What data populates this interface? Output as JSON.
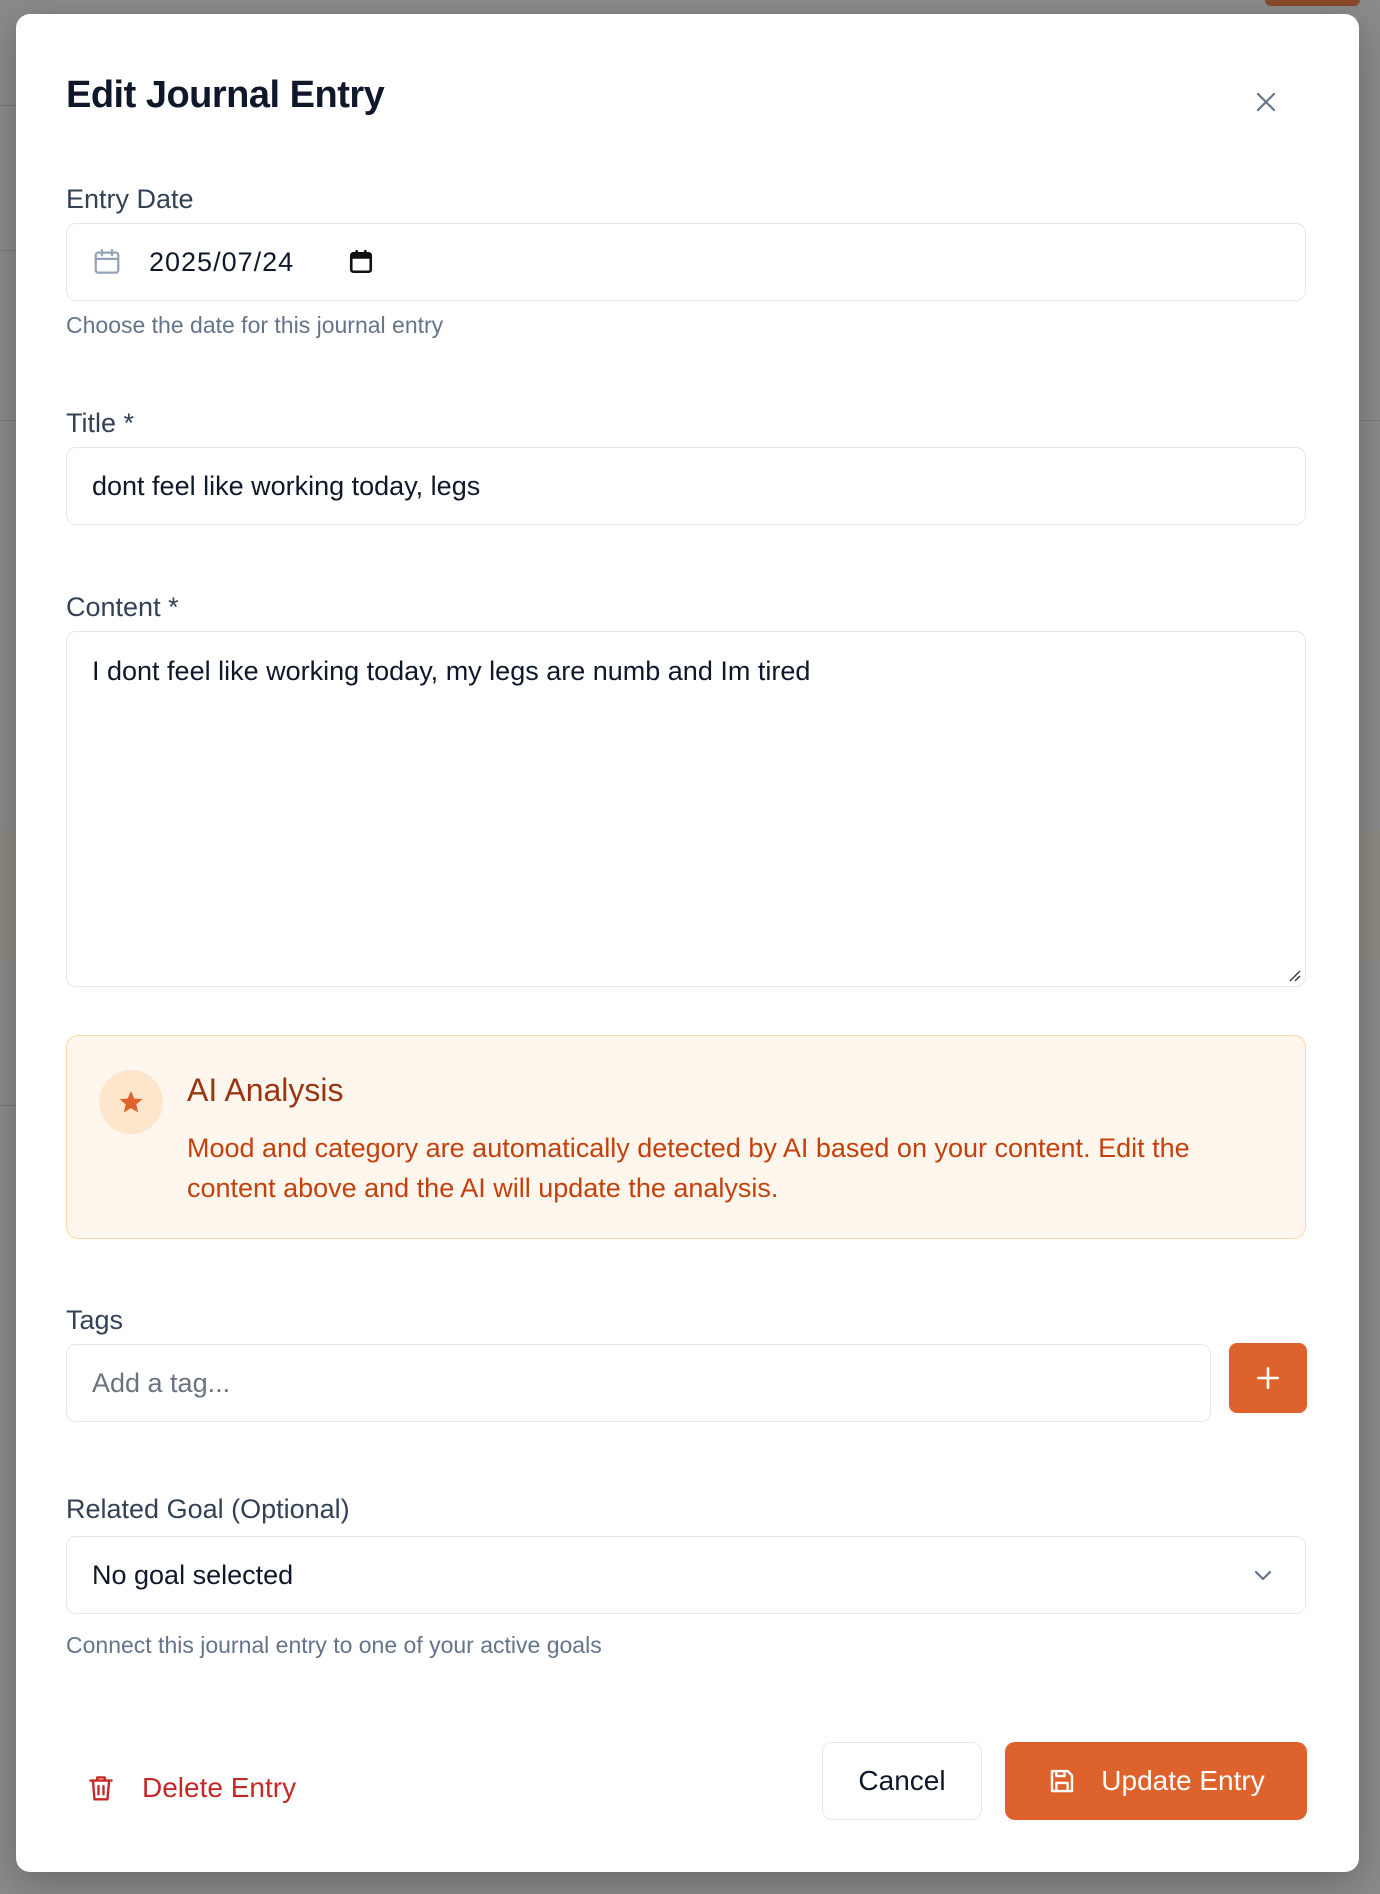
{
  "modal": {
    "title": "Edit Journal Entry"
  },
  "entry_date": {
    "label": "Entry Date",
    "value": "2025/07/24",
    "hint": "Choose the date for this journal entry"
  },
  "title_field": {
    "label": "Title *",
    "value": "dont feel like working today, legs"
  },
  "content_field": {
    "label": "Content *",
    "value": "I dont feel like working today, my legs are numb and Im tired"
  },
  "ai_analysis": {
    "title": "AI Analysis",
    "description": "Mood and category are automatically detected by AI based on your content. Edit the content above and the AI will update the analysis."
  },
  "tags": {
    "label": "Tags",
    "placeholder": "Add a tag..."
  },
  "related_goal": {
    "label": "Related Goal (Optional)",
    "selected": "No goal selected",
    "hint": "Connect this journal entry to one of your active goals"
  },
  "actions": {
    "delete_label": "Delete Entry",
    "cancel_label": "Cancel",
    "update_label": "Update Entry"
  },
  "colors": {
    "accent": "#dd622b",
    "danger": "#c62828",
    "ai_background": "#fff7ed",
    "ai_text": "#c2410c"
  },
  "icons": [
    "close-icon",
    "calendar-icon",
    "calendar-picker-icon",
    "star-icon",
    "plus-icon",
    "chevron-down-icon",
    "trash-icon",
    "save-icon"
  ]
}
